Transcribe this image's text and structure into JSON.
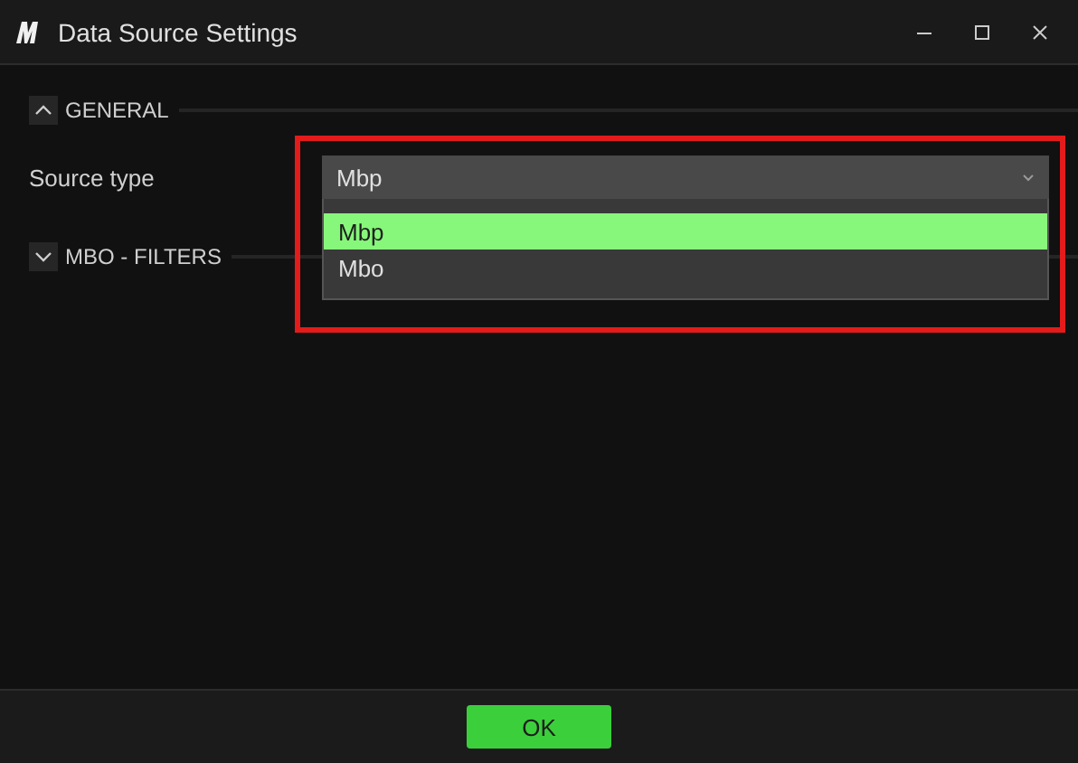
{
  "window": {
    "title": "Data Source Settings"
  },
  "sections": [
    {
      "title": "GENERAL",
      "expanded": true,
      "fields": [
        {
          "label": "Source type",
          "value": "Mbp",
          "dropdown": {
            "open": true,
            "options": [
              {
                "label": "Mbp",
                "selected": true
              },
              {
                "label": "Mbo",
                "selected": false
              }
            ]
          }
        }
      ]
    },
    {
      "title": "MBO - FILTERS",
      "expanded": false
    }
  ],
  "buttons": [
    {
      "label": "OK"
    }
  ]
}
